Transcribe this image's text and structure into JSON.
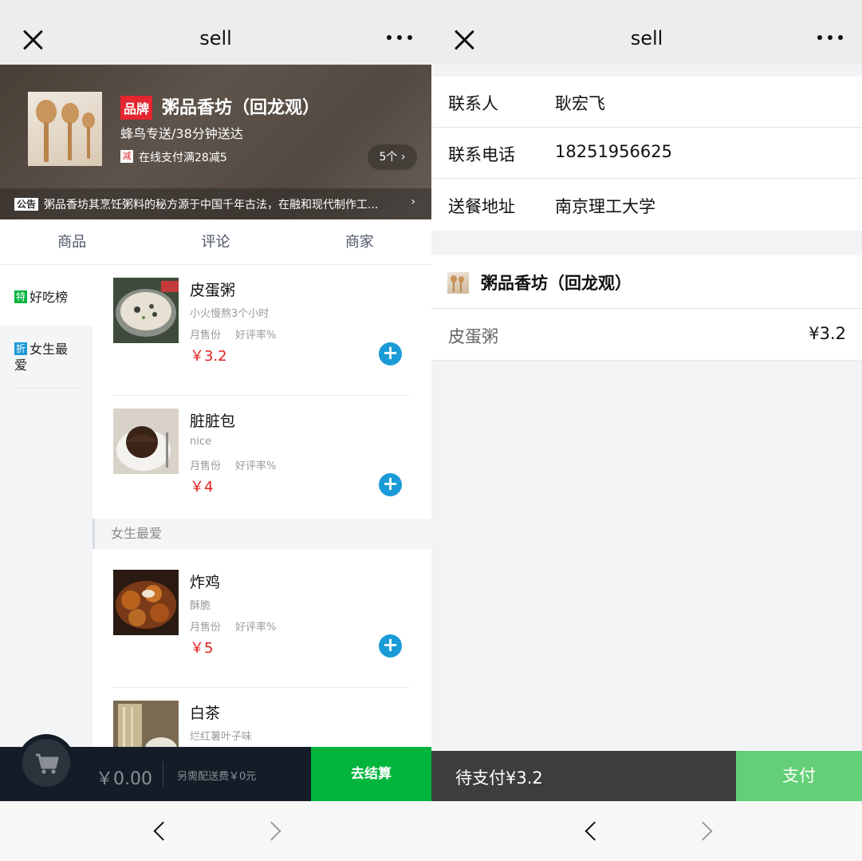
{
  "left": {
    "nav": {
      "title": "sell"
    },
    "header": {
      "brand_tag": "品牌",
      "shop_name": "粥品香坊（回龙观）",
      "delivery": "蜂鸟专送/38分钟送达",
      "discount_icon": "减",
      "discount_text": "在线支付满28减5",
      "support_count": "5个 ›",
      "notice_tag": "公告",
      "notice_text": "粥品香坊其烹饪粥料的秘方源于中国千年古法，在融和现代制作工...",
      "notice_arrow": "›"
    },
    "tabs": [
      "商品",
      "评论",
      "商家"
    ],
    "categories": [
      {
        "badge": "特",
        "label": "好吃榜"
      },
      {
        "badge": "折",
        "label": "女生最爱"
      }
    ],
    "section_title": "女生最爱",
    "foods": [
      {
        "name": "皮蛋粥",
        "desc": "小火慢熬3个小时",
        "sales": "月售份",
        "rating": "好评率%",
        "price": "￥3.2"
      },
      {
        "name": "脏脏包",
        "desc": "nice",
        "sales": "月售份",
        "rating": "好评率%",
        "price": "￥4"
      },
      {
        "name": "炸鸡",
        "desc": "酥脆",
        "sales": "月售份",
        "rating": "好评率%",
        "price": "￥5"
      },
      {
        "name": "白茶",
        "desc": "烂红薯叶子味",
        "sales": "月售份",
        "rating": "好评率%",
        "price": ""
      }
    ],
    "add_label": "+",
    "cart": {
      "price": "￥0.00",
      "fee": "另需配送费￥0元",
      "checkout": "去结算"
    }
  },
  "right": {
    "nav": {
      "title": "sell"
    },
    "form": [
      {
        "label": "联系人",
        "value": "耿宏飞"
      },
      {
        "label": "联系电话",
        "value": "18251956625"
      },
      {
        "label": "送餐地址",
        "value": "南京理工大学"
      }
    ],
    "order": {
      "shop_name": "粥品香坊（回龙观）",
      "item_name": "皮蛋粥",
      "item_price": "¥3.2"
    },
    "paybar": {
      "text": "待支付¥3.2",
      "pay": "支付"
    }
  },
  "colors": {
    "brand_red": "#e3262f",
    "add_blue": "#1a9bd7",
    "checkout_green": "#00b43c",
    "pay_green": "#63cf76",
    "price_red": "#e02020"
  }
}
